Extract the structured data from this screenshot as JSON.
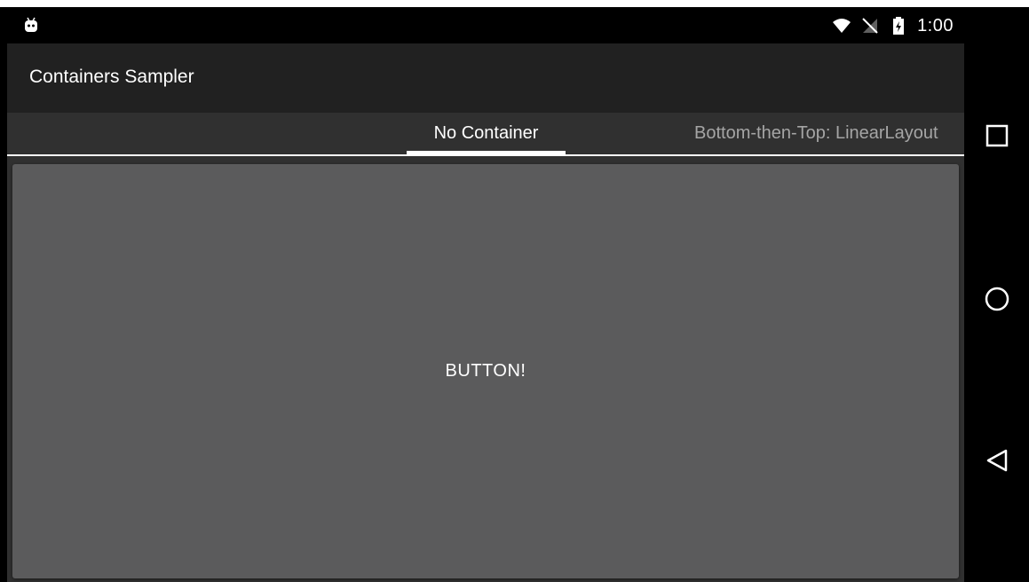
{
  "status_bar": {
    "time": "1:00",
    "icons": [
      "android-icon",
      "wifi-icon",
      "no-sim-icon",
      "battery-charging-icon"
    ]
  },
  "toolbar": {
    "title": "Containers Sampler"
  },
  "tabs": [
    {
      "label": "No Container",
      "selected": true
    },
    {
      "label": "Bottom-then-Top: LinearLayout",
      "selected": false
    }
  ],
  "content": {
    "button_label": "BUTTON!"
  },
  "nav_bar": {
    "buttons": [
      "recents-icon",
      "home-icon",
      "back-icon"
    ]
  },
  "colors": {
    "toolbar": "#212121",
    "background": "#303030",
    "button": "#5b5b5c",
    "active_tab_text": "#ffffff",
    "inactive_tab_text": "#a5a5a5"
  }
}
